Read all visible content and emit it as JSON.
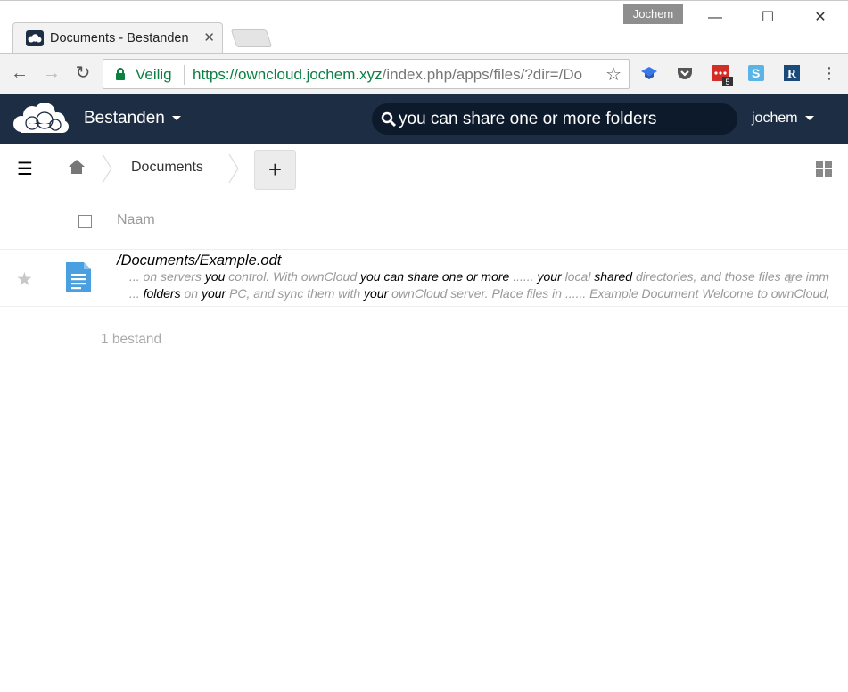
{
  "browser": {
    "tab_title": "Documents - Bestanden",
    "profile_name": "Jochem",
    "security_label": "Veilig",
    "url_host": "https://owncloud.jochem.xyz",
    "url_path": "/index.php/apps/files/?dir=/Do",
    "extension_badge": "5",
    "extensions": [
      "graduation-cap-icon",
      "pocket-icon",
      "lastpass-icon",
      "s-extension-icon",
      "r-extension-icon"
    ]
  },
  "app": {
    "name": "Bestanden",
    "search_value": "you can share one or more folders",
    "user": "jochem",
    "header_color": "#1d2d44"
  },
  "breadcrumb": {
    "current": "Documents"
  },
  "file_list": {
    "column_name": "Naam",
    "rows": [
      {
        "name": "/Documents/Example.odt",
        "excerpt_line1": [
          {
            "t": "... on servers ",
            "m": false
          },
          {
            "t": "you",
            "m": true
          },
          {
            "t": " control. With ownCloud ",
            "m": false
          },
          {
            "t": "you can share one or more",
            "m": true
          },
          {
            "t": " ...... ",
            "m": false
          },
          {
            "t": "your",
            "m": true
          },
          {
            "t": " local ",
            "m": false
          },
          {
            "t": "shared",
            "m": true
          },
          {
            "t": " directories, and those files are imm",
            "m": false
          }
        ],
        "excerpt_line2": [
          {
            "t": "... ",
            "m": false
          },
          {
            "t": "folders",
            "m": true
          },
          {
            "t": " on ",
            "m": false
          },
          {
            "t": "your",
            "m": true
          },
          {
            "t": " PC, and sync them with ",
            "m": false
          },
          {
            "t": "your",
            "m": true
          },
          {
            "t": " ownCloud server. Place files in ...... Example Document Welcome to ownCloud,",
            "m": false
          }
        ]
      }
    ],
    "summary": "1 bestand"
  }
}
